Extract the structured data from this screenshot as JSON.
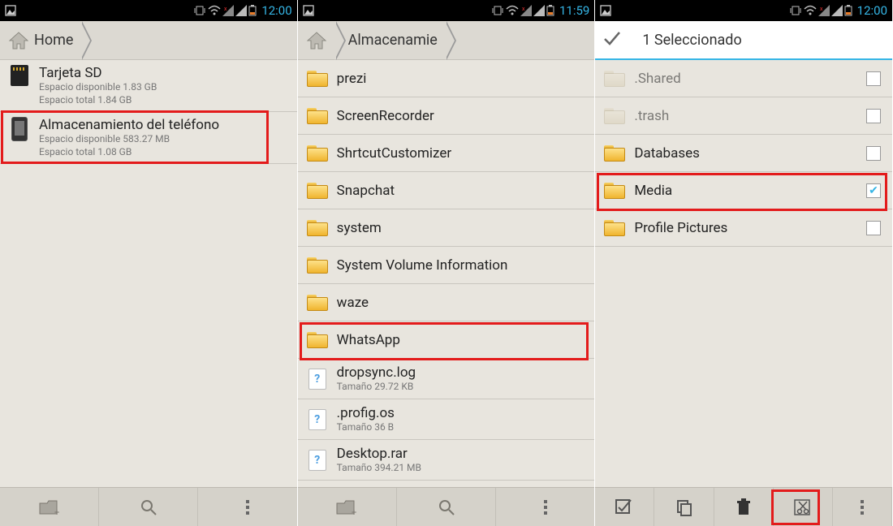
{
  "status": {
    "time1": "12:00",
    "time2": "11:59",
    "time3": "12:00"
  },
  "screen1": {
    "breadcrumb": "Home",
    "items": [
      {
        "title": "Tarjeta SD",
        "line1": "Espacio disponible 1.83 GB",
        "line2": "Espacio total 1.84 GB",
        "icon": "sd"
      },
      {
        "title": "Almacenamiento del teléfono",
        "line1": "Espacio disponible 583.27 MB",
        "line2": "Espacio total 1.08 GB",
        "icon": "phone"
      }
    ]
  },
  "screen2": {
    "breadcrumb": "Almacenamie",
    "folders": [
      "prezi",
      "ScreenRecorder",
      "ShrtcutCustomizer",
      "Snapchat",
      "system",
      "System Volume Information",
      "waze",
      "WhatsApp"
    ],
    "files": [
      {
        "name": "dropsync.log",
        "size": "Tamaño 29.72 KB"
      },
      {
        "name": ".profig.os",
        "size": "Tamaño 36 B"
      },
      {
        "name": "Desktop.rar",
        "size": "Tamaño 394.21 MB"
      }
    ]
  },
  "screen3": {
    "header": "1 Seleccionado",
    "items": [
      {
        "name": ".Shared",
        "faded": true,
        "checked": false
      },
      {
        "name": ".trash",
        "faded": true,
        "checked": false
      },
      {
        "name": "Databases",
        "faded": false,
        "checked": false
      },
      {
        "name": "Media",
        "faded": false,
        "checked": true
      },
      {
        "name": "Profile Pictures",
        "faded": false,
        "checked": false
      }
    ]
  }
}
